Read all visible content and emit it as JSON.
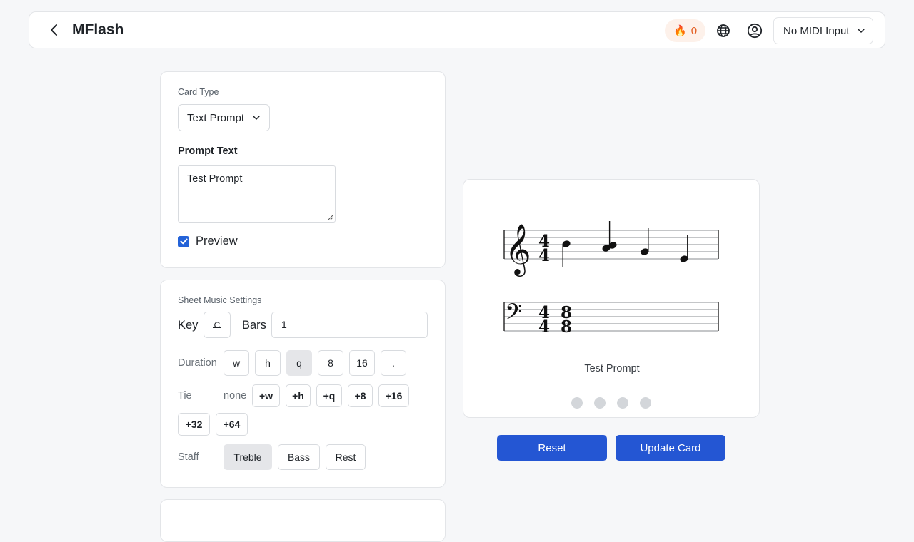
{
  "header": {
    "title": "MFlash",
    "streak_count": "0",
    "midi_label": "No MIDI Input"
  },
  "card_editor": {
    "card_type_label": "Card Type",
    "card_type_value": "Text Prompt",
    "prompt_text_label": "Prompt Text",
    "prompt_text_value": "Test Prompt",
    "preview_label": "Preview",
    "preview_checked": true
  },
  "sheet_settings": {
    "title": "Sheet Music Settings",
    "key_label": "Key",
    "key_value": "C",
    "bars_label": "Bars",
    "bars_value": "1",
    "duration_label": "Duration",
    "durations": [
      "w",
      "h",
      "q",
      "8",
      "16",
      "."
    ],
    "duration_selected": "q",
    "tie_label": "Tie",
    "tie_value": "none",
    "ties": [
      "+w",
      "+h",
      "+q",
      "+8",
      "+16",
      "+32",
      "+64"
    ],
    "staff_label": "Staff",
    "staffs": [
      "Treble",
      "Bass",
      "Rest"
    ],
    "staff_selected": "Treble"
  },
  "preview_card": {
    "caption": "Test Prompt",
    "time_signature": "4/4",
    "page_dots": 4
  },
  "actions": {
    "reset_label": "Reset",
    "update_label": "Update Card"
  },
  "colors": {
    "accent": "#2456d3",
    "checkbox": "#2463d8",
    "streak_text": "#e25b1e",
    "streak_bg": "#fdf1ea"
  }
}
